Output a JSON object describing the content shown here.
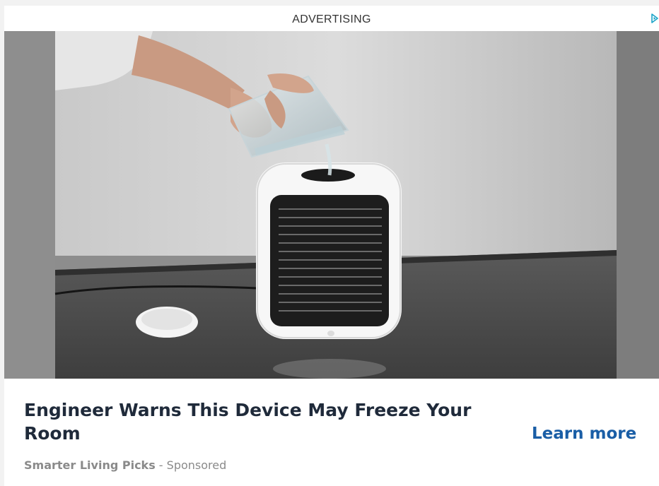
{
  "ad": {
    "label": "ADVERTISING",
    "headline": "Engineer Warns This Device May Freeze Your Room",
    "cta_label": "Learn more",
    "brand": "Smarter Living Picks",
    "separator": " - ",
    "sponsored": "Sponsored"
  },
  "icons": {
    "adchoices": "adchoices-icon"
  },
  "colors": {
    "headline": "#1f2a3a",
    "cta": "#1a5ea6",
    "meta": "#8a8a8a"
  }
}
